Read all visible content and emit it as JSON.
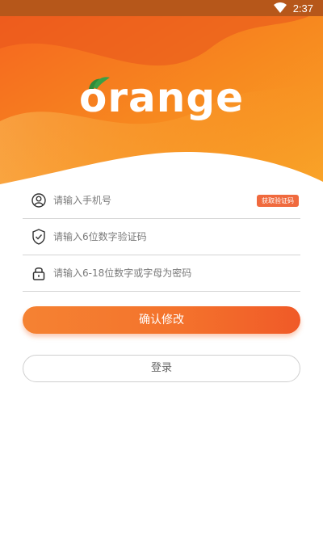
{
  "status_bar": {
    "time": "2:37",
    "wifi_icon": "wifi-icon"
  },
  "header": {
    "logo_text": "orange",
    "leaf_icon": "leaf-icon"
  },
  "form": {
    "phone": {
      "placeholder": "请输入手机号",
      "icon": "user-icon"
    },
    "get_code_label": "获取验证码",
    "code": {
      "placeholder": "请输入6位数字验证码",
      "icon": "shield-check-icon"
    },
    "password": {
      "placeholder": "请输入6-18位数字或字母为密码",
      "icon": "lock-icon"
    }
  },
  "actions": {
    "confirm_label": "确认修改",
    "login_label": "登录"
  },
  "colors": {
    "brand_orange": "#f47a2e",
    "header_dark": "#e5561e",
    "button_start": "#f58232",
    "button_end": "#f05a28"
  }
}
